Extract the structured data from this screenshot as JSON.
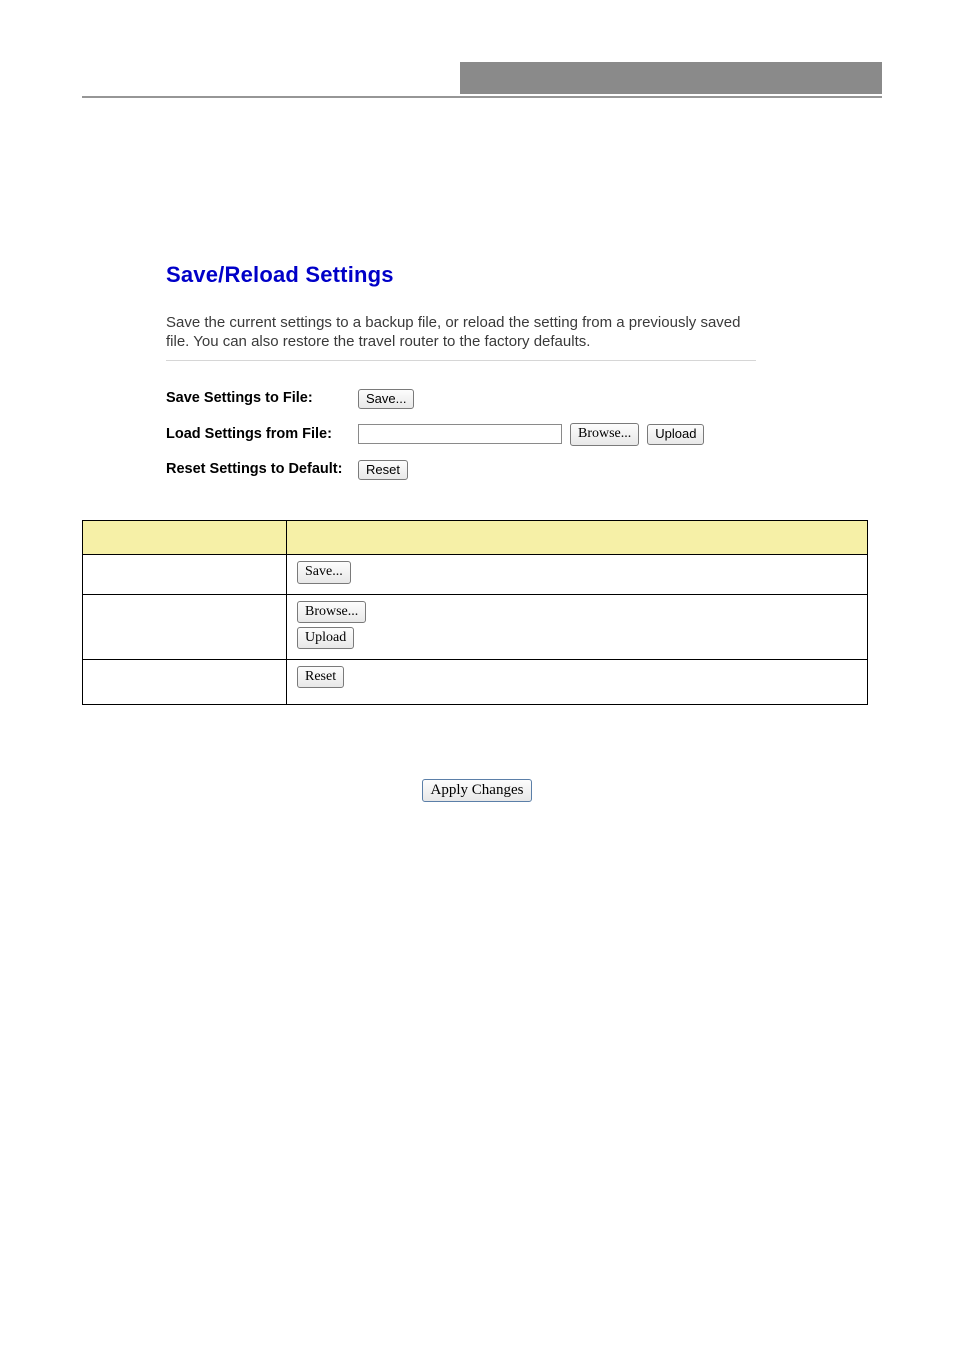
{
  "panel": {
    "title": "Save/Reload Settings",
    "description": "Save the current settings to a backup file, or reload the setting from a previously saved file. You can also restore the travel router to the factory defaults.",
    "rows": {
      "save": {
        "label": "Save Settings to File:",
        "button": "Save..."
      },
      "load": {
        "label": "Load Settings from File:",
        "browse": "Browse...",
        "upload": "Upload"
      },
      "reset": {
        "label": "Reset Settings to Default:",
        "button": "Reset"
      }
    }
  },
  "table": {
    "header": {
      "item": "",
      "desc": ""
    },
    "rows": [
      {
        "item": "",
        "buttons": [
          "Save..."
        ],
        "desc_after": ""
      },
      {
        "item": "",
        "buttons": [
          "Browse...",
          "Upload"
        ],
        "desc_after": ""
      },
      {
        "item": "",
        "buttons": [
          "Reset"
        ],
        "desc_after": ""
      }
    ]
  },
  "apply": {
    "label": "Apply Changes"
  }
}
